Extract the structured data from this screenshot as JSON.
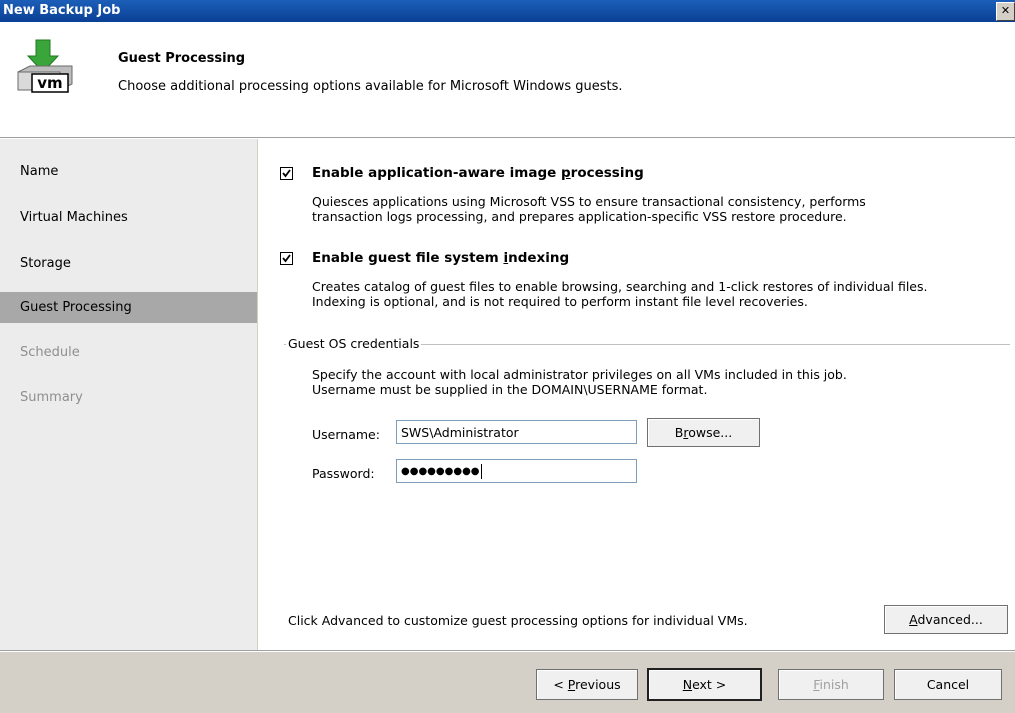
{
  "window": {
    "title": "New Backup Job",
    "close_glyph": "✕"
  },
  "header": {
    "title": "Guest Processing",
    "subtitle": "Choose additional processing options available for Microsoft Windows guests.",
    "icon": "backup-vm-icon",
    "icon_text": "vm"
  },
  "nav": {
    "items": [
      {
        "label": "Name",
        "state": "enabled"
      },
      {
        "label": "Virtual Machines",
        "state": "enabled"
      },
      {
        "label": "Storage",
        "state": "enabled"
      },
      {
        "label": "Guest Processing",
        "state": "selected"
      },
      {
        "label": "Schedule",
        "state": "disabled"
      },
      {
        "label": "Summary",
        "state": "disabled"
      }
    ]
  },
  "options": {
    "app_aware": {
      "label_before": "Enable application-aware image ",
      "label_accel": "p",
      "label_after": "rocessing",
      "checked": true,
      "desc_line1": "Quiesces applications using Microsoft VSS to ensure transactional consistency, performs",
      "desc_line2": "transaction logs processing, and prepares application-specific VSS restore procedure."
    },
    "indexing": {
      "label_before": "Enable guest file system ",
      "label_accel": "i",
      "label_after": "ndexing",
      "checked": true,
      "desc_line1": "Creates catalog of guest files to enable browsing, searching and 1-click restores of individual files.",
      "desc_line2": "Indexing is optional, and is not required to perform instant file level recoveries."
    }
  },
  "credentials": {
    "group_label": "Guest OS credentials",
    "desc_line1": "Specify the account with local administrator privileges on all VMs included in this job.",
    "desc_line2": "Username must be supplied in the DOMAIN\\USERNAME format.",
    "username_label": "Username:",
    "username_value": "SWS\\Administrator",
    "password_label": "Password:",
    "password_value": "●●●●●●●●●",
    "browse_label_before": "B",
    "browse_label_accel": "r",
    "browse_label_after": "owse..."
  },
  "advanced": {
    "hint": "Click Advanced to customize guest processing options for individual VMs.",
    "button_accel": "A",
    "button_after": "dvanced..."
  },
  "footer": {
    "previous_before": "< ",
    "previous_accel": "P",
    "previous_after": "revious",
    "next_accel": "N",
    "next_after": "ext >",
    "finish_accel": "F",
    "finish_after": "inish",
    "cancel_label": "Cancel"
  },
  "colors": {
    "title_bar": "#0a3f95",
    "nav_selected": "#a8a8a8",
    "nav_background": "#ececec",
    "disabled_text": "#8f8f8f",
    "header_icon_arrow": "#3aa53a"
  }
}
